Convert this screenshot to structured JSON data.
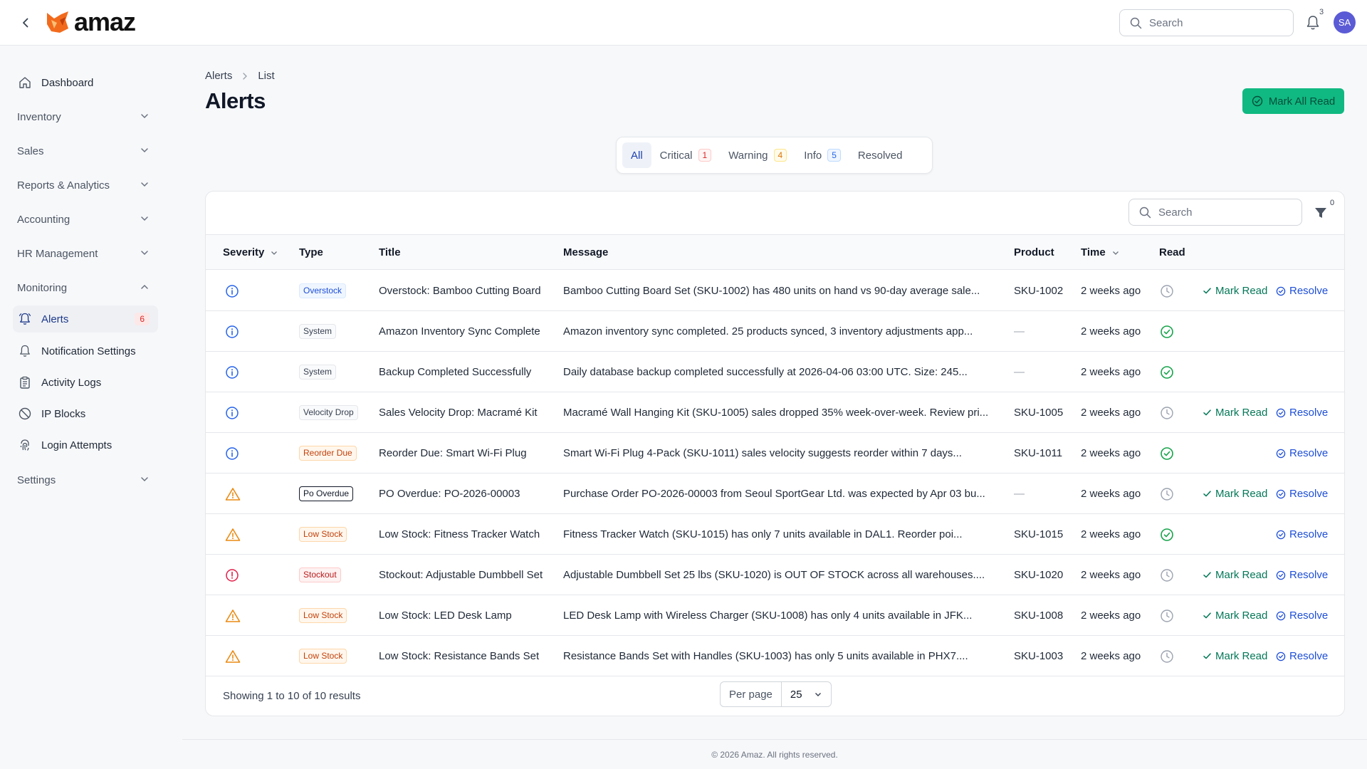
{
  "app": {
    "name": "amaz"
  },
  "topbar": {
    "search_placeholder": "Search",
    "notification_count": "3",
    "avatar_initials": "SA"
  },
  "sidebar": {
    "dashboard": "Dashboard",
    "inventory": "Inventory",
    "sales": "Sales",
    "reports": "Reports & Analytics",
    "accounting": "Accounting",
    "hr": "HR Management",
    "monitoring": "Monitoring",
    "alerts": "Alerts",
    "alerts_count": "6",
    "notification_settings": "Notification Settings",
    "activity_logs": "Activity Logs",
    "ip_blocks": "IP Blocks",
    "login_attempts": "Login Attempts",
    "settings": "Settings"
  },
  "breadcrumb": {
    "root": "Alerts",
    "current": "List"
  },
  "page": {
    "title": "Alerts",
    "mark_all_read": "Mark All Read"
  },
  "tabs": {
    "all": "All",
    "critical": "Critical",
    "critical_count": "1",
    "warning": "Warning",
    "warning_count": "4",
    "info": "Info",
    "info_count": "5",
    "resolved": "Resolved"
  },
  "table": {
    "search_placeholder": "Search",
    "filter_count": "0",
    "columns": {
      "severity": "Severity",
      "type": "Type",
      "title": "Title",
      "message": "Message",
      "product": "Product",
      "time": "Time",
      "read": "Read"
    },
    "mark_read_label": "Mark Read",
    "resolve_label": "Resolve",
    "rows": [
      {
        "severity": "info",
        "type": "Overstock",
        "type_style": "blue",
        "title": "Overstock: Bamboo Cutting Board",
        "message": "Bamboo Cutting Board Set (SKU-1002) has 480 units on hand vs 90-day average sale...",
        "product": "SKU-1002",
        "time": "2 weeks ago",
        "read": false,
        "resolved": false
      },
      {
        "severity": "info",
        "type": "System",
        "type_style": "gray",
        "title": "Amazon Inventory Sync Complete",
        "message": "Amazon inventory sync completed. 25 products synced, 3 inventory adjustments app...",
        "product": "—",
        "time": "2 weeks ago",
        "read": true,
        "resolved": true
      },
      {
        "severity": "info",
        "type": "System",
        "type_style": "gray",
        "title": "Backup Completed Successfully",
        "message": "Daily database backup completed successfully at 2026-04-06 03:00 UTC. Size: 245...",
        "product": "—",
        "time": "2 weeks ago",
        "read": true,
        "resolved": true
      },
      {
        "severity": "info",
        "type": "Velocity Drop",
        "type_style": "gray",
        "title": "Sales Velocity Drop: Macramé Kit",
        "message": "Macramé Wall Hanging Kit (SKU-1005) sales dropped 35% week-over-week. Review pri...",
        "product": "SKU-1005",
        "time": "2 weeks ago",
        "read": false,
        "resolved": false
      },
      {
        "severity": "info",
        "type": "Reorder Due",
        "type_style": "orange",
        "title": "Reorder Due: Smart Wi-Fi Plug",
        "message": "Smart Wi-Fi Plug 4-Pack (SKU-1011) sales velocity suggests reorder within 7 days...",
        "product": "SKU-1011",
        "time": "2 weeks ago",
        "read": true,
        "resolved": false
      },
      {
        "severity": "warning",
        "type": "Po Overdue",
        "type_style": "dark",
        "title": "PO Overdue: PO-2026-00003",
        "message": "Purchase Order PO-2026-00003 from Seoul SportGear Ltd. was expected by Apr 03 bu...",
        "product": "—",
        "time": "2 weeks ago",
        "read": false,
        "resolved": false
      },
      {
        "severity": "warning",
        "type": "Low Stock",
        "type_style": "orange",
        "title": "Low Stock: Fitness Tracker Watch",
        "message": "Fitness Tracker Watch (SKU-1015) has only 7 units available in DAL1. Reorder poi...",
        "product": "SKU-1015",
        "time": "2 weeks ago",
        "read": true,
        "resolved": false
      },
      {
        "severity": "critical",
        "type": "Stockout",
        "type_style": "red",
        "title": "Stockout: Adjustable Dumbbell Set",
        "message": "Adjustable Dumbbell Set 25 lbs (SKU-1020) is OUT OF STOCK across all warehouses....",
        "product": "SKU-1020",
        "time": "2 weeks ago",
        "read": false,
        "resolved": false
      },
      {
        "severity": "warning",
        "type": "Low Stock",
        "type_style": "orange",
        "title": "Low Stock: LED Desk Lamp",
        "message": "LED Desk Lamp with Wireless Charger (SKU-1008) has only 4 units available in JFK...",
        "product": "SKU-1008",
        "time": "2 weeks ago",
        "read": false,
        "resolved": false
      },
      {
        "severity": "warning",
        "type": "Low Stock",
        "type_style": "orange",
        "title": "Low Stock: Resistance Bands Set",
        "message": "Resistance Bands Set with Handles (SKU-1003) has only 5 units available in PHX7....",
        "product": "SKU-1003",
        "time": "2 weeks ago",
        "read": false,
        "resolved": false
      }
    ],
    "results_text": "Showing 1 to 10 of 10 results",
    "per_page_label": "Per page",
    "per_page_value": "25"
  },
  "footer": {
    "copyright": "© 2026 Amaz. All rights reserved."
  },
  "colors": {
    "brand": "#f26b1d",
    "accent_green": "#10b981",
    "info_blue": "#2563eb",
    "warning_orange": "#ea8a12",
    "critical_red": "#e11d48",
    "read_green": "#16a34a"
  }
}
